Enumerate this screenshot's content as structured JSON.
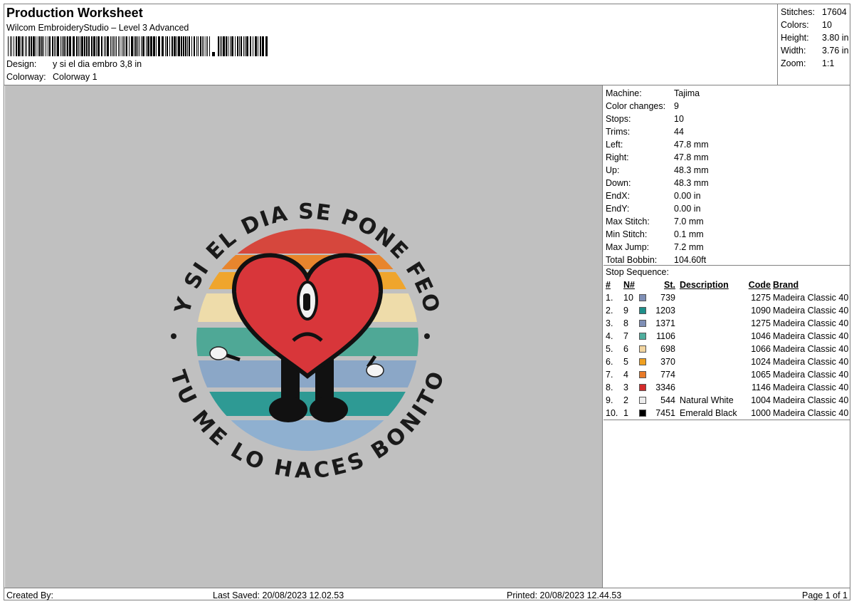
{
  "header": {
    "title": "Production Worksheet",
    "subtitle": "Wilcom EmbroideryStudio – Level 3 Advanced",
    "design_label": "Design:",
    "design_value": "y si el dia embro 3,8 in",
    "colorway_label": "Colorway:",
    "colorway_value": "Colorway 1"
  },
  "summary": [
    {
      "label": "Stitches:",
      "value": "17604"
    },
    {
      "label": "Colors:",
      "value": "10"
    },
    {
      "label": "Height:",
      "value": "3.80 in"
    },
    {
      "label": "Width:",
      "value": "3.76 in"
    },
    {
      "label": "Zoom:",
      "value": "1:1"
    }
  ],
  "machine_info": [
    {
      "label": "Machine:",
      "value": "Tajima"
    },
    {
      "label": "Color changes:",
      "value": "9"
    },
    {
      "label": "Stops:",
      "value": "10"
    },
    {
      "label": "Trims:",
      "value": "44"
    },
    {
      "label": "Left:",
      "value": "47.8 mm"
    },
    {
      "label": "Right:",
      "value": "47.8 mm"
    },
    {
      "label": "Up:",
      "value": "48.3 mm"
    },
    {
      "label": "Down:",
      "value": "48.3 mm"
    },
    {
      "label": "EndX:",
      "value": "0.00 in"
    },
    {
      "label": "EndY:",
      "value": "0.00 in"
    },
    {
      "label": "Max Stitch:",
      "value": "7.0 mm"
    },
    {
      "label": "Min Stitch:",
      "value": "0.1 mm"
    },
    {
      "label": "Max Jump:",
      "value": "7.2 mm"
    },
    {
      "label": "Total Bobbin:",
      "value": "104.60ft"
    }
  ],
  "stop_sequence": {
    "title": "Stop Sequence:",
    "columns": [
      "#",
      "N#",
      "St.",
      "Description",
      "Code",
      "Brand"
    ],
    "rows": [
      {
        "idx": "1.",
        "n": "10",
        "color": "#7f8fb6",
        "st": "739",
        "desc": "",
        "code": "1275",
        "brand": "Madeira Classic 40"
      },
      {
        "idx": "2.",
        "n": "9",
        "color": "#1f8f8a",
        "st": "1203",
        "desc": "",
        "code": "1090",
        "brand": "Madeira Classic 40"
      },
      {
        "idx": "3.",
        "n": "8",
        "color": "#7f8fb6",
        "st": "1371",
        "desc": "",
        "code": "1275",
        "brand": "Madeira Classic 40"
      },
      {
        "idx": "4.",
        "n": "7",
        "color": "#4fae9e",
        "st": "1106",
        "desc": "",
        "code": "1046",
        "brand": "Madeira Classic 40"
      },
      {
        "idx": "5.",
        "n": "6",
        "color": "#f2d5a0",
        "st": "698",
        "desc": "",
        "code": "1066",
        "brand": "Madeira Classic 40"
      },
      {
        "idx": "6.",
        "n": "5",
        "color": "#f0a020",
        "st": "370",
        "desc": "",
        "code": "1024",
        "brand": "Madeira Classic 40"
      },
      {
        "idx": "7.",
        "n": "4",
        "color": "#e87a28",
        "st": "774",
        "desc": "",
        "code": "1065",
        "brand": "Madeira Classic 40"
      },
      {
        "idx": "8.",
        "n": "3",
        "color": "#d42a2a",
        "st": "3346",
        "desc": "",
        "code": "1146",
        "brand": "Madeira Classic 40"
      },
      {
        "idx": "9.",
        "n": "2",
        "color": "#ececec",
        "st": "544",
        "desc": "Natural White",
        "code": "1004",
        "brand": "Madeira Classic 40"
      },
      {
        "idx": "10.",
        "n": "1",
        "color": "#000000",
        "st": "7451",
        "desc": "Emerald Black",
        "code": "1000",
        "brand": "Madeira Classic 40"
      }
    ]
  },
  "design_art": {
    "top_text": "Y SI EL DIA SE PONE FEO",
    "bottom_text": "TU ME LO HACES BONITO"
  },
  "footer": {
    "created_by": "Created By:",
    "last_saved": "Last Saved: 20/08/2023 12.02.53",
    "printed": "Printed: 20/08/2023 12.44.53",
    "page": "Page 1 of 1"
  }
}
